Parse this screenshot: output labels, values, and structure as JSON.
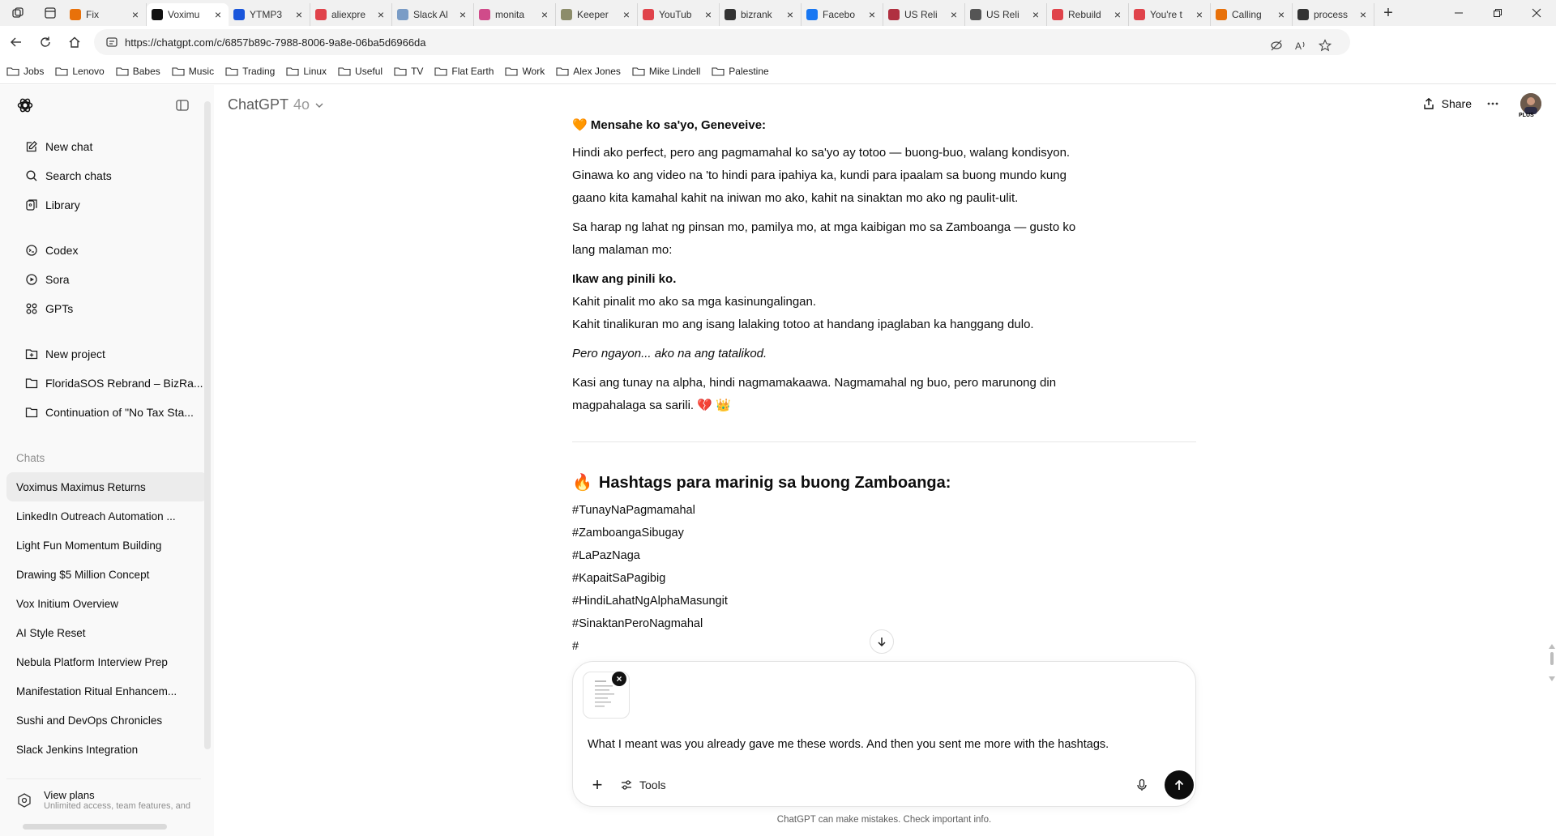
{
  "browser": {
    "tabs": [
      {
        "label": "Fix",
        "fav_color": "#e8710a"
      },
      {
        "label": "Voximu",
        "fav_color": "#111111",
        "active": true
      },
      {
        "label": "YTMP3",
        "fav_color": "#1a56db"
      },
      {
        "label": "aliexpre",
        "fav_color": "#e0434b"
      },
      {
        "label": "Slack Al",
        "fav_color": "#7a9cc6"
      },
      {
        "label": "monita",
        "fav_color": "#d04b8a"
      },
      {
        "label": "Keeper",
        "fav_color": "#8c8c6a"
      },
      {
        "label": "YouTub",
        "fav_color": "#e0434b"
      },
      {
        "label": "bizrank",
        "fav_color": "#333333"
      },
      {
        "label": "Facebo",
        "fav_color": "#1877f2"
      },
      {
        "label": "US Reli",
        "fav_color": "#b03040"
      },
      {
        "label": "US Reli",
        "fav_color": "#555555"
      },
      {
        "label": "Rebuild",
        "fav_color": "#e0434b"
      },
      {
        "label": "You're t",
        "fav_color": "#e0434b"
      },
      {
        "label": "Calling",
        "fav_color": "#e8710a"
      },
      {
        "label": "process",
        "fav_color": "#333333"
      }
    ],
    "url": "https://chatgpt.com/c/6857b89c-7988-8006-9a8e-06ba5d6966da",
    "bookmarks": [
      "Jobs",
      "Lenovo",
      "Babes",
      "Music",
      "Trading",
      "Linux",
      "Useful",
      "TV",
      "Flat Earth",
      "Work",
      "Alex Jones",
      "Mike Lindell",
      "Palestine"
    ]
  },
  "sidebar": {
    "nav": [
      {
        "label": "New chat",
        "icon": "edit-icon"
      },
      {
        "label": "Search chats",
        "icon": "search-icon"
      },
      {
        "label": "Library",
        "icon": "library-icon"
      }
    ],
    "nav2": [
      {
        "label": "Codex",
        "icon": "codex-icon"
      },
      {
        "label": "Sora",
        "icon": "sora-icon"
      },
      {
        "label": "GPTs",
        "icon": "gpts-icon"
      }
    ],
    "projects": [
      {
        "label": "New project",
        "icon": "new-folder-icon"
      },
      {
        "label": "FloridaSOS Rebrand – BizRa...",
        "icon": "folder-icon"
      },
      {
        "label": "Continuation of \"No Tax Sta...",
        "icon": "folder-icon"
      }
    ],
    "chats_heading": "Chats",
    "chats": [
      "Voximus Maximus Returns",
      "LinkedIn Outreach Automation ...",
      "Light Fun Momentum Building",
      "Drawing $5 Million Concept",
      "Vox Initium Overview",
      "AI Style Reset",
      "Nebula Platform Interview Prep",
      "Manifestation Ritual Enhancem...",
      "Sushi and DevOps Chronicles",
      "Slack Jenkins Integration"
    ],
    "view_plans": {
      "title": "View plans",
      "subtitle": "Unlimited access, team features, and"
    }
  },
  "header": {
    "model_name": "ChatGPT",
    "model_version": "4o",
    "share_label": "Share",
    "plan_badge": "PLUS"
  },
  "message": {
    "heading_icon": "🧡",
    "heading": "Mensahe ko sa'yo, Geneveive:",
    "p1": "Hindi ako perfect, pero ang pagmamahal ko sa'yo ay totoo — buong-buo, walang kondisyon. Ginawa ko ang video na 'to hindi para ipahiya ka, kundi para ipaalam sa buong mundo kung gaano kita kamahal kahit na iniwan mo ako, kahit na sinaktan mo ako ng paulit-ulit.",
    "p2": "Sa harap ng lahat ng pinsan mo, pamilya mo, at mga kaibigan mo sa Zamboanga — gusto ko lang malaman mo:",
    "bold_line": "Ikaw ang pinili ko.",
    "line2": "Kahit pinalit mo ako sa mga kasinungalingan.",
    "line3": "Kahit tinalikuran mo ang isang lalaking totoo at handang ipaglaban ka hanggang dulo.",
    "italic": "Pero ngayon... ako na ang tatalikod.",
    "p4": "Kasi ang tunay na alpha, hindi nagmamakaawa. Nagmamahal ng buo, pero marunong din magpahalaga sa sarili. 💔 👑",
    "hashtag_icon": "🔥",
    "hashtag_heading": "Hashtags para marinig sa buong Zamboanga:",
    "hashtags": [
      "#TunayNaPagmamahal",
      "#ZamboangaSibugay",
      "#LaPazNaga",
      "#KapaitSaPagibig",
      "#HindiLahatNgAlphaMasungit",
      "#SinaktanPeroNagmahal",
      "#"
    ]
  },
  "composer": {
    "text": "What I meant was you already gave me these words. And then you sent me more with the hashtags.",
    "tools_label": "Tools"
  },
  "disclaimer": "ChatGPT can make mistakes. Check important info."
}
